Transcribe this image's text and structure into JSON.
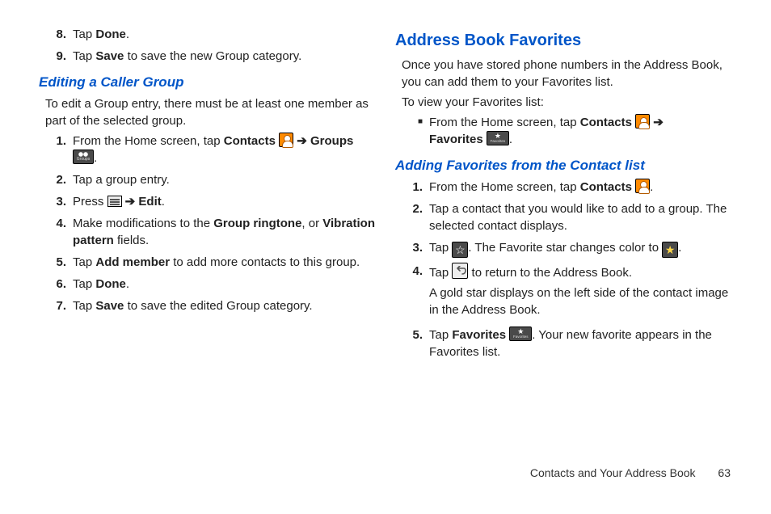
{
  "left": {
    "cont8_num": "8.",
    "cont8": {
      "pre": "Tap ",
      "b": "Done",
      "post": "."
    },
    "cont9_num": "9.",
    "cont9": {
      "pre": "Tap ",
      "b": "Save",
      "post": " to save the new Group category."
    },
    "subhead": "Editing a Caller Group",
    "intro": "To edit a Group entry, there must be at least one member as part of the selected group.",
    "s1_num": "1.",
    "s1": {
      "pre": "From the Home screen, tap ",
      "b1": "Contacts",
      "arrow": " ➔ ",
      "b2": "Groups",
      "post": "."
    },
    "s2_num": "2.",
    "s2": "Tap a group entry.",
    "s3_num": "3.",
    "s3": {
      "pre": "Press ",
      "arrow": " ➔ ",
      "b": "Edit",
      "post": "."
    },
    "s4_num": "4.",
    "s4": {
      "pre": "Make modifications to the ",
      "b1": "Group ringtone",
      "mid": ", or ",
      "b2": "Vibration pattern",
      "post": " fields."
    },
    "s5_num": "5.",
    "s5": {
      "pre": "Tap ",
      "b": "Add member",
      "post": " to add more contacts to this group."
    },
    "s6_num": "6.",
    "s6": {
      "pre": "Tap ",
      "b": "Done",
      "post": "."
    },
    "s7_num": "7.",
    "s7": {
      "pre": "Tap ",
      "b": "Save",
      "post": " to save the edited Group category."
    }
  },
  "right": {
    "head": "Address Book Favorites",
    "intro1": "Once you have stored phone numbers in the Address Book, you can add them to your Favorites list.",
    "intro2": "To view your Favorites list:",
    "bullet": {
      "pre": "From the Home screen, tap ",
      "b1": "Contacts",
      "arrow": " ➔ ",
      "b2": "Favorites",
      "post": "."
    },
    "subhead": "Adding Favorites from the Contact list",
    "s1_num": "1.",
    "s1": {
      "pre": "From the Home screen, tap ",
      "b": "Contacts",
      "post": "."
    },
    "s2_num": "2.",
    "s2": "Tap a contact that you would like to add to a group. The selected contact displays.",
    "s3_num": "3.",
    "s3": {
      "pre": "Tap ",
      "mid": ". The Favorite star changes color to ",
      "post": "."
    },
    "s4_num": "4.",
    "s4": {
      "pre": "Tap ",
      "mid": " to return to the Address Book.",
      "note": "A gold star displays on the left side of the contact image in the Address Book."
    },
    "s5_num": "5.",
    "s5": {
      "pre": "Tap ",
      "b": "Favorites",
      "post": ". Your new favorite appears in the Favorites list."
    }
  },
  "footer": {
    "chapter": "Contacts and Your Address Book",
    "page": "63"
  }
}
